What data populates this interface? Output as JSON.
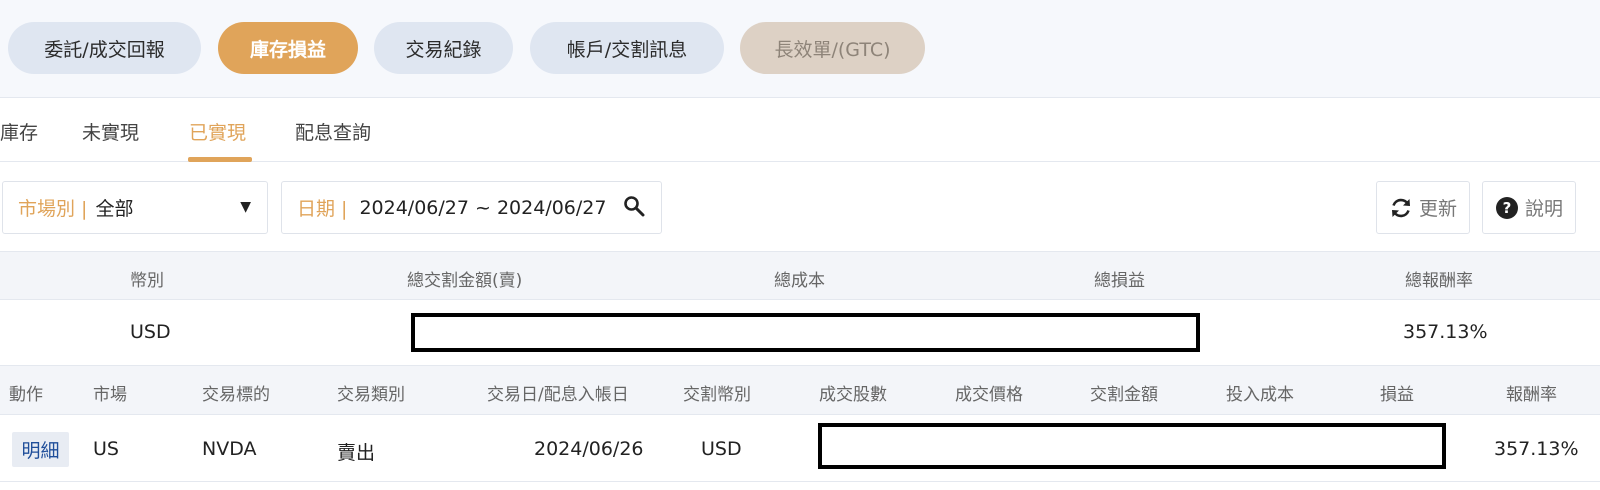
{
  "top_tabs": [
    {
      "label": "委託/成交回報"
    },
    {
      "label": "庫存損益"
    },
    {
      "label": "交易紀錄"
    },
    {
      "label": "帳戶/交割訊息"
    },
    {
      "label": "長效單/(GTC)"
    }
  ],
  "sub_tabs": [
    {
      "label": "庫存"
    },
    {
      "label": "未實現"
    },
    {
      "label": "已實現"
    },
    {
      "label": "配息查詢"
    }
  ],
  "filters": {
    "market": {
      "label": "市場別 |",
      "value": "全部"
    },
    "date": {
      "label": "日期 |",
      "value": "2024/06/27 ~ 2024/06/27"
    }
  },
  "actions": {
    "refresh": "更新",
    "help": "說明"
  },
  "summary": {
    "headers": [
      "幣別",
      "總交割金額(賣)",
      "總成本",
      "總損益",
      "總報酬率"
    ],
    "row": {
      "currency": "USD",
      "return_rate": "357.13%"
    }
  },
  "detail": {
    "headers": [
      "動作",
      "市場",
      "交易標的",
      "交易類別",
      "交易日/配息入帳日",
      "交割幣別",
      "成交股數",
      "成交價格",
      "交割金額",
      "投入成本",
      "損益",
      "報酬率"
    ],
    "row": {
      "action": "明細",
      "market": "US",
      "symbol": "NVDA",
      "type": "賣出",
      "date": "2024/06/26",
      "currency": "USD",
      "return_rate": "357.13%"
    }
  },
  "colors": {
    "accent": "#e0a45a",
    "pill_bg": "#dfe6f1",
    "link": "#1f4e9a"
  },
  "icons": {
    "dropdown": "triangle-down-icon",
    "search": "magnifier-icon",
    "refresh": "refresh-icon",
    "help": "question-circle-icon"
  }
}
